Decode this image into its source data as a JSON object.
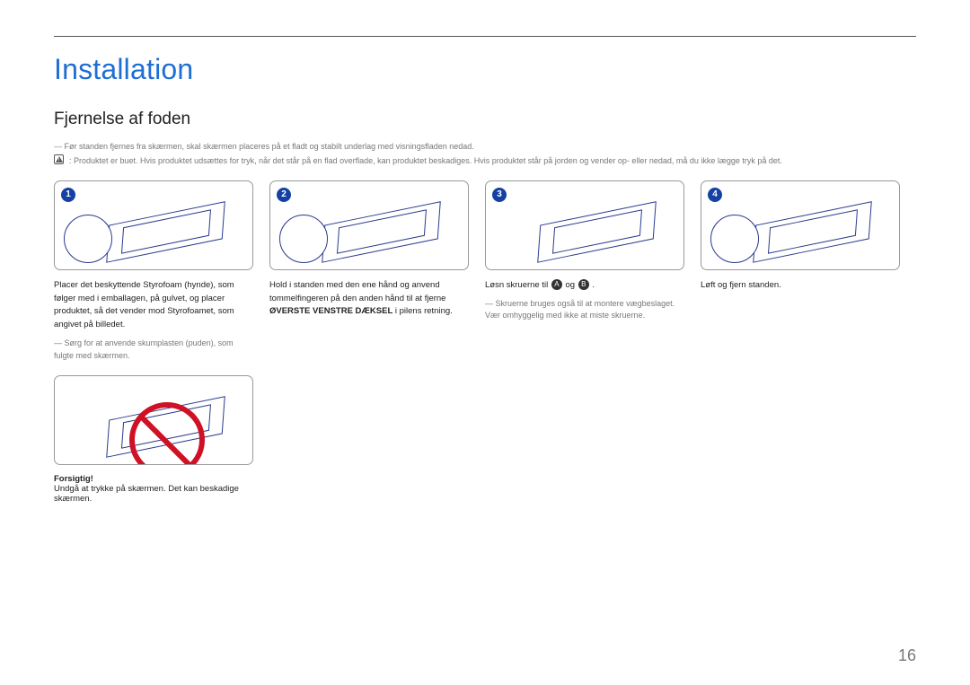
{
  "page_number": "16",
  "title": "Installation",
  "subtitle": "Fjernelse af foden",
  "intro_note": "Før standen fjernes fra skærmen, skal skærmen placeres på et fladt og stabilt underlag med visningsfladen nedad.",
  "caution_note": ": Produktet er buet. Hvis produktet udsættes for tryk, når det står på en flad overflade, kan produktet beskadiges. Hvis produktet står på jorden og vender op- eller nedad, må du ikke lægge tryk på det.",
  "steps": {
    "s1": {
      "num": "1",
      "text": "Placer det beskyttende Styrofoam (hynde), som følger med i emballagen, på gulvet, og placer produktet, så det vender mod Styrofoamet, som angivet på billedet.",
      "note": "Sørg for at anvende skumplasten (puden), som fulgte med skærmen."
    },
    "s2": {
      "num": "2",
      "text_pre": "Hold i standen med den ene hånd og anvend tommelfingeren på den anden hånd til at fjerne ",
      "text_bold": "ØVERSTE VENSTRE DÆKSEL",
      "text_post": " i pilens retning."
    },
    "s3": {
      "num": "3",
      "text_pre": "Løsn skruerne til ",
      "badge_a": "A",
      "text_mid": " og ",
      "badge_b": "B",
      "text_post": " .",
      "note": "Skruerne bruges også til at montere vægbeslaget. Vær omhyggelig med ikke at miste skruerne."
    },
    "s4": {
      "num": "4",
      "text": "Løft og fjern standen."
    }
  },
  "forsigtig": {
    "label": "Forsigtig!",
    "text": "Undgå at trykke på skærmen. Det kan beskadige skærmen."
  }
}
